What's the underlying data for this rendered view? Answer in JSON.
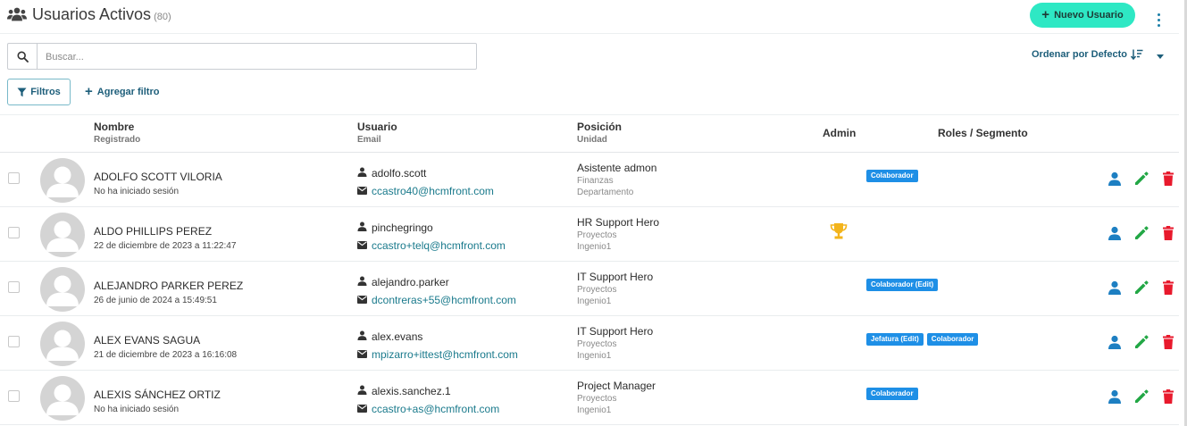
{
  "header": {
    "title": "Usuarios Activos",
    "count": "(80)",
    "new_user_label": "Nuevo Usuario"
  },
  "search": {
    "placeholder": "Buscar..."
  },
  "sort": {
    "label": "Ordenar por Defecto"
  },
  "filters": {
    "filters_label": "Filtros",
    "add_filter_label": "Agregar filtro"
  },
  "table": {
    "headers": {
      "name": "Nombre",
      "name_sub": "Registrado",
      "user": "Usuario",
      "user_sub": "Email",
      "position": "Posición",
      "position_sub": "Unidad",
      "admin": "Admin",
      "roles": "Roles / Segmento"
    },
    "rows": [
      {
        "name": "ADOLFO SCOTT VILORIA",
        "registered": "No ha iniciado sesión",
        "username": "adolfo.scott",
        "email": "ccastro40@hcmfront.com",
        "position": "Asistente admon",
        "unit1": "Finanzas",
        "unit2": "Departamento",
        "admin": false,
        "roles": [
          "Colaborador"
        ]
      },
      {
        "name": "ALDO PHILLIPS PEREZ",
        "registered": "22 de diciembre de 2023 a 11:22:47",
        "username": "pinchegringo",
        "email": "ccastro+telq@hcmfront.com",
        "position": "HR Support Hero",
        "unit1": "Proyectos",
        "unit2": "Ingenio1",
        "admin": true,
        "roles": []
      },
      {
        "name": "ALEJANDRO PARKER PEREZ",
        "registered": "26 de junio de 2024 a 15:49:51",
        "username": "alejandro.parker",
        "email": "dcontreras+55@hcmfront.com",
        "position": "IT Support Hero",
        "unit1": "Proyectos",
        "unit2": "Ingenio1",
        "admin": false,
        "roles": [
          "Colaborador (Edit)"
        ]
      },
      {
        "name": "ALEX EVANS SAGUA",
        "registered": "21 de diciembre de 2023 a 16:16:08",
        "username": "alex.evans",
        "email": "mpizarro+ittest@hcmfront.com",
        "position": "IT Support Hero",
        "unit1": "Proyectos",
        "unit2": "Ingenio1",
        "admin": false,
        "roles": [
          "Jefatura (Edit)",
          "Colaborador"
        ]
      },
      {
        "name": "ALEXIS SÁNCHEZ ORTIZ",
        "registered": "No ha iniciado sesión",
        "username": "alexis.sanchez.1",
        "email": "ccastro+as@hcmfront.com",
        "position": "Project Manager",
        "unit1": "Proyectos",
        "unit2": "Ingenio1",
        "admin": false,
        "roles": [
          "Colaborador"
        ]
      }
    ]
  },
  "colors": {
    "primary_button": "#2ee8c4",
    "link": "#1a7a8c",
    "badge": "#1e8fe6",
    "view_icon": "#1d7fc2",
    "edit_icon": "#22a745",
    "delete_icon": "#e8192c",
    "trophy": "#f3b41b"
  },
  "icons": {
    "header": "users-group-icon",
    "search": "search-icon",
    "sort": "sort-descending-icon",
    "filter": "filter-icon",
    "row_actions": [
      "user-view-icon",
      "pencil-edit-icon",
      "trash-delete-icon"
    ]
  }
}
